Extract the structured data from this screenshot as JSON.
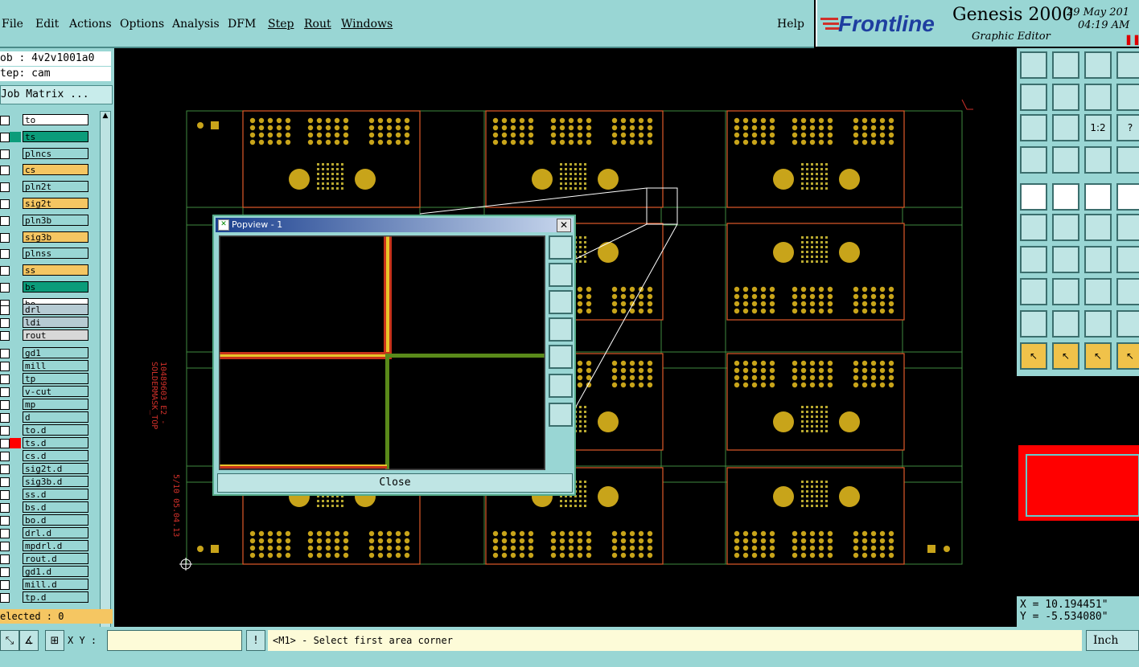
{
  "menu": {
    "items": [
      "File",
      "Edit",
      "Actions",
      "Options",
      "Analysis",
      "DFM",
      "Step",
      "Rout",
      "Windows"
    ],
    "help": "Help"
  },
  "brand": {
    "logo": "Frontline",
    "product": "Genesis 2000",
    "subtitle": "Graphic Editor",
    "date": "29 May 201",
    "time": "04:19 AM"
  },
  "job": {
    "job_line": "ob : 4v2v1001a0",
    "step_line": "tep: cam",
    "matrix_button": "Job Matrix ...",
    "selected": "elected : 0"
  },
  "layers": [
    {
      "name": "to",
      "color": "#ffffff"
    },
    {
      "name": "ts",
      "color": "#0b9c7a",
      "active": true
    },
    {
      "name": "plncs",
      "color": "#99d6d4"
    },
    {
      "name": "cs",
      "color": "#f5c662"
    },
    {
      "name": "pln2t",
      "color": "#99d6d4"
    },
    {
      "name": "sig2t",
      "color": "#f5c662"
    },
    {
      "name": "pln3b",
      "color": "#99d6d4"
    },
    {
      "name": "sig3b",
      "color": "#f5c662"
    },
    {
      "name": "plnss",
      "color": "#99d6d4"
    },
    {
      "name": "ss",
      "color": "#f5c662"
    },
    {
      "name": "bs",
      "color": "#0b9c7a"
    },
    {
      "name": "bo",
      "color": "#ffffff"
    },
    {
      "name": "drl",
      "color": "#b6cbd3"
    },
    {
      "name": "ldi",
      "color": "#b6cbd3"
    },
    {
      "name": "rout",
      "color": "#d8d8d8"
    },
    {
      "name": "gd1",
      "color": "#99d6d4"
    },
    {
      "name": "mill",
      "color": "#99d6d4"
    },
    {
      "name": "tp",
      "color": "#99d6d4"
    },
    {
      "name": "v-cut",
      "color": "#99d6d4"
    },
    {
      "name": "mp",
      "color": "#99d6d4"
    },
    {
      "name": "d",
      "color": "#99d6d4"
    },
    {
      "name": "to.d",
      "color": "#99d6d4"
    },
    {
      "name": "ts.d",
      "color": "#99d6d4",
      "marked": true
    },
    {
      "name": "cs.d",
      "color": "#99d6d4"
    },
    {
      "name": "sig2t.d",
      "color": "#99d6d4"
    },
    {
      "name": "sig3b.d",
      "color": "#99d6d4"
    },
    {
      "name": "ss.d",
      "color": "#99d6d4"
    },
    {
      "name": "bs.d",
      "color": "#99d6d4"
    },
    {
      "name": "bo.d",
      "color": "#99d6d4"
    },
    {
      "name": "drl.d",
      "color": "#99d6d4"
    },
    {
      "name": "mpdrl.d",
      "color": "#99d6d4"
    },
    {
      "name": "rout.d",
      "color": "#99d6d4"
    },
    {
      "name": "gd1.d",
      "color": "#99d6d4"
    },
    {
      "name": "mill.d",
      "color": "#99d6d4"
    },
    {
      "name": "tp.d",
      "color": "#99d6d4"
    }
  ],
  "canvas": {
    "side_text_1": "10489603 E2 - SOLDERMASK_TOP",
    "side_text_2": "5/10  05.04.13"
  },
  "popview": {
    "title": "Popview - 1",
    "close": "Close"
  },
  "tools": {
    "zoom_1to1": "1:2",
    "help": "?"
  },
  "coords": {
    "x": "X =  10.194451\"",
    "y": "Y =  -5.534080\""
  },
  "bottom": {
    "xy_label": "X Y :",
    "xy_value": "",
    "status": "<M1> - Select first area corner",
    "unit": "Inch"
  },
  "colors": {
    "panel": "#99d6d4",
    "copper": "#c8a41a",
    "outline": "#e05a2a",
    "grid": "#3f8a3f"
  }
}
